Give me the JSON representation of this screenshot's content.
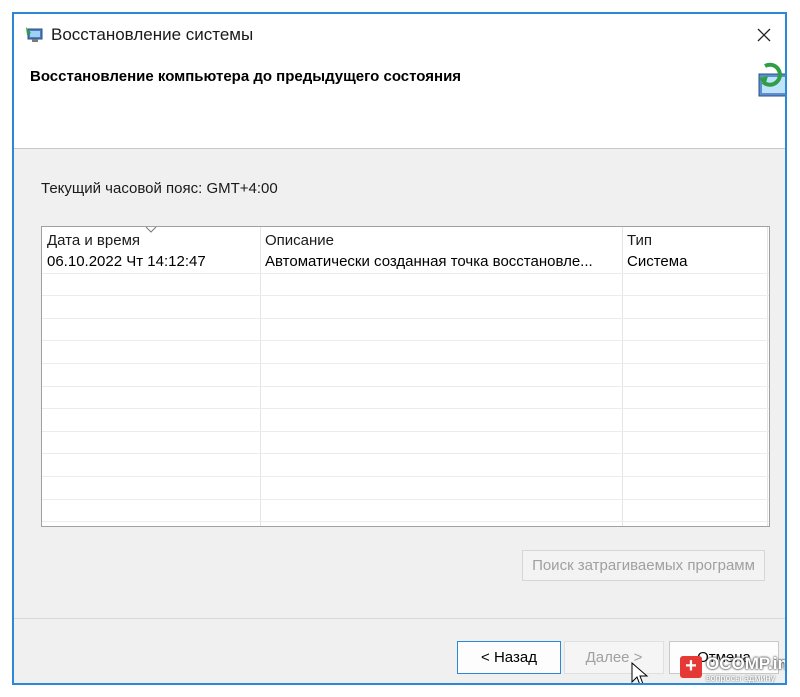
{
  "window": {
    "title": "Восстановление системы",
    "icon": "system-restore-icon"
  },
  "header": {
    "title": "Восстановление компьютера до предыдущего состояния",
    "icon": "restore-monitor-icon"
  },
  "timezone_label": "Текущий часовой пояс: GMT+4:00",
  "table": {
    "columns": [
      "Дата и время",
      "Описание",
      "Тип"
    ],
    "sorted_column": "Дата и время",
    "rows": [
      [
        "06.10.2022 Чт 14:12:47",
        "Автоматически созданная точка восстановле...",
        "Система"
      ]
    ]
  },
  "buttons": {
    "affected_programs": "Поиск затрагиваемых программ",
    "back": "< Назад",
    "next": "Далее >",
    "cancel": "Отмена"
  },
  "watermark": {
    "brand": "OCOMP.info",
    "tagline": "вопросы админу"
  },
  "colors": {
    "accent": "#2b88d8",
    "header_bg": "#ffffff",
    "body_bg": "#f0f0f0",
    "disabled_text": "#a0a0a0"
  }
}
